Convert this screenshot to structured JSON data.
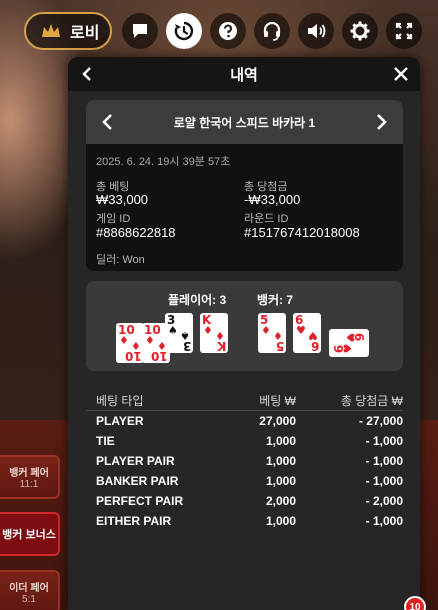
{
  "topbar": {
    "lobby_label": "로비",
    "icons": [
      "chat-icon",
      "history-icon",
      "help-icon",
      "headset-icon",
      "volume-icon",
      "settings-icon",
      "fullscreen-icon"
    ]
  },
  "side": {
    "tile1_label": "뱅커 페어",
    "tile1_sub": "11:1",
    "tile2_label": "뱅커 보너스",
    "tile3_label": "이더 페어",
    "tile3_sub": "5:1"
  },
  "modal": {
    "title": "내역",
    "game_name": "로얄 한국어 스피드 바카라 1",
    "date": "2025. 6. 24. 19시 39분 57초",
    "total_bet_label": "총 베팅",
    "total_bet_value": "₩33,000",
    "total_win_label": "총 당첨금",
    "total_win_value": "-₩33,000",
    "game_id_label": "게임 ID",
    "game_id_value": "#8868622818",
    "round_id_label": "라운드 ID",
    "round_id_value": "#151767412018008",
    "dealer": "딜러: Won",
    "player_label": "플레이어: 3",
    "banker_label": "뱅커: 7"
  },
  "player_cards": [
    {
      "rank": "10",
      "suit": "♦",
      "color": "red"
    },
    {
      "rank": "10",
      "suit": "♦",
      "color": "red"
    },
    {
      "rank": "3",
      "suit": "♠",
      "color": "black"
    },
    {
      "rank": "K",
      "suit": "♦",
      "color": "red"
    }
  ],
  "banker_cards": [
    {
      "rank": "5",
      "suit": "♦",
      "color": "red"
    },
    {
      "rank": "6",
      "suit": "♥",
      "color": "red"
    },
    {
      "rank": "6",
      "suit": "♥",
      "color": "red"
    }
  ],
  "bets": {
    "headers": [
      "베팅 타입",
      "베팅 ₩",
      "총 당첨금 ₩"
    ],
    "rows": [
      {
        "type": "PLAYER",
        "bet": "27,000",
        "win": "- 27,000"
      },
      {
        "type": "TIE",
        "bet": "1,000",
        "win": "- 1,000"
      },
      {
        "type": "PLAYER PAIR",
        "bet": "1,000",
        "win": "- 1,000"
      },
      {
        "type": "BANKER PAIR",
        "bet": "1,000",
        "win": "- 1,000"
      },
      {
        "type": "PERFECT PAIR",
        "bet": "2,000",
        "win": "- 2,000"
      },
      {
        "type": "EITHER PAIR",
        "bet": "1,000",
        "win": "- 1,000"
      }
    ]
  },
  "notification_count": "10",
  "colors": {
    "accent": "#d8a04a",
    "panel": "#262626",
    "card_red": "#e0202a"
  }
}
